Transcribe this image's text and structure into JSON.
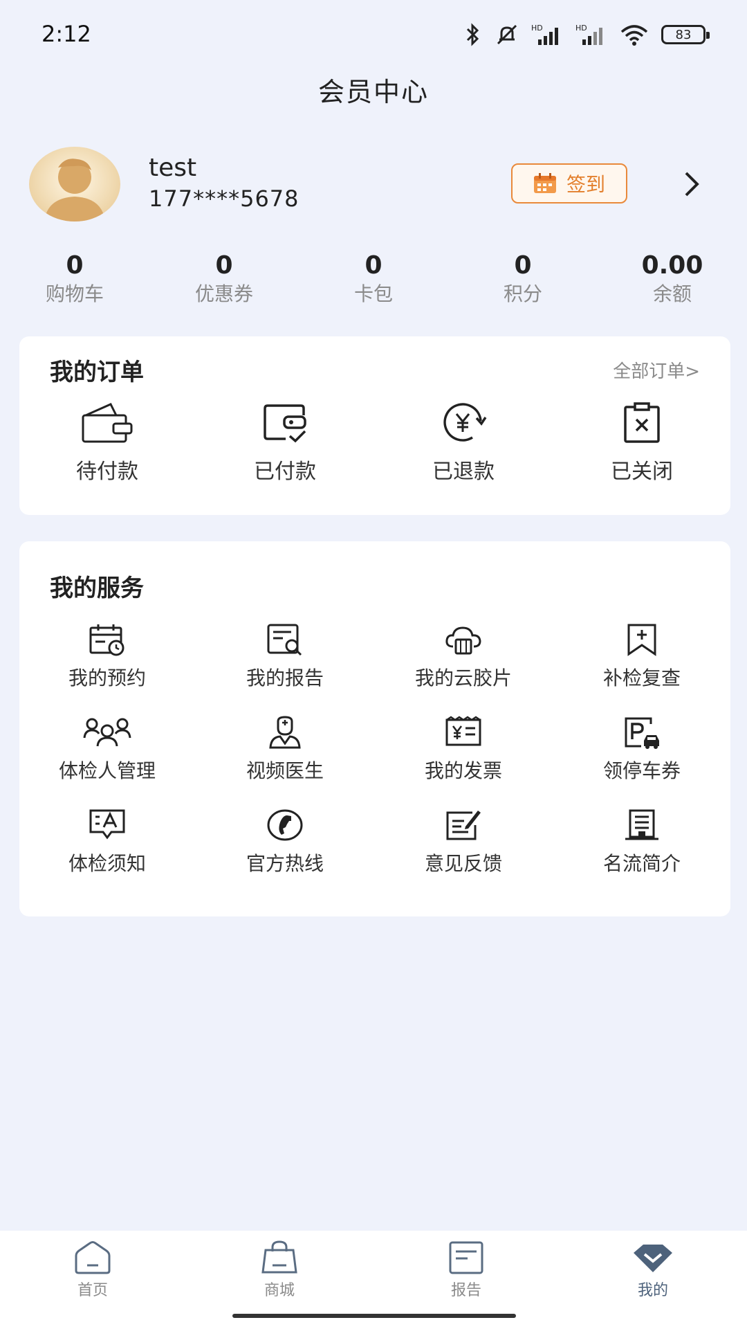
{
  "status_bar": {
    "time": "2:12",
    "battery": "83",
    "icons": [
      "bluetooth-icon",
      "mute-icon",
      "signal-hd-icon",
      "signal-hd-icon",
      "wifi-icon",
      "battery-icon"
    ]
  },
  "header": {
    "title": "会员中心"
  },
  "profile": {
    "name": "test",
    "phone": "177****5678",
    "sign_in_label": "签到",
    "accent": "#e9893a"
  },
  "stats": [
    {
      "value": "0",
      "label": "购物车"
    },
    {
      "value": "0",
      "label": "优惠券"
    },
    {
      "value": "0",
      "label": "卡包"
    },
    {
      "value": "0",
      "label": "积分"
    },
    {
      "value": "0.00",
      "label": "余额"
    }
  ],
  "orders": {
    "title": "我的订单",
    "all_label": "全部订单>",
    "items": [
      {
        "label": "待付款",
        "icon": "wallet-icon"
      },
      {
        "label": "已付款",
        "icon": "wallet-check-icon"
      },
      {
        "label": "已退款",
        "icon": "yuan-refund-icon"
      },
      {
        "label": "已关闭",
        "icon": "clipboard-x-icon"
      }
    ]
  },
  "services": {
    "title": "我的服务",
    "items": [
      {
        "label": "我的预约",
        "icon": "calendar-clock-icon"
      },
      {
        "label": "我的报告",
        "icon": "report-search-icon"
      },
      {
        "label": "我的云胶片",
        "icon": "cloud-film-icon"
      },
      {
        "label": "补检复查",
        "icon": "bookmark-plus-icon"
      },
      {
        "label": "体检人管理",
        "icon": "people-icon"
      },
      {
        "label": "视频医生",
        "icon": "doctor-icon"
      },
      {
        "label": "我的发票",
        "icon": "invoice-icon"
      },
      {
        "label": "领停车券",
        "icon": "parking-icon"
      },
      {
        "label": "体检须知",
        "icon": "notice-icon"
      },
      {
        "label": "官方热线",
        "icon": "phone-icon"
      },
      {
        "label": "意见反馈",
        "icon": "feedback-icon"
      },
      {
        "label": "名流简介",
        "icon": "building-icon"
      }
    ]
  },
  "bottom_nav": {
    "active_color": "#4d627b",
    "items": [
      {
        "label": "首页",
        "icon": "home-icon"
      },
      {
        "label": "商城",
        "icon": "shopping-bag-icon"
      },
      {
        "label": "报告",
        "icon": "report-icon"
      },
      {
        "label": "我的",
        "icon": "profile-diamond-icon"
      }
    ]
  }
}
